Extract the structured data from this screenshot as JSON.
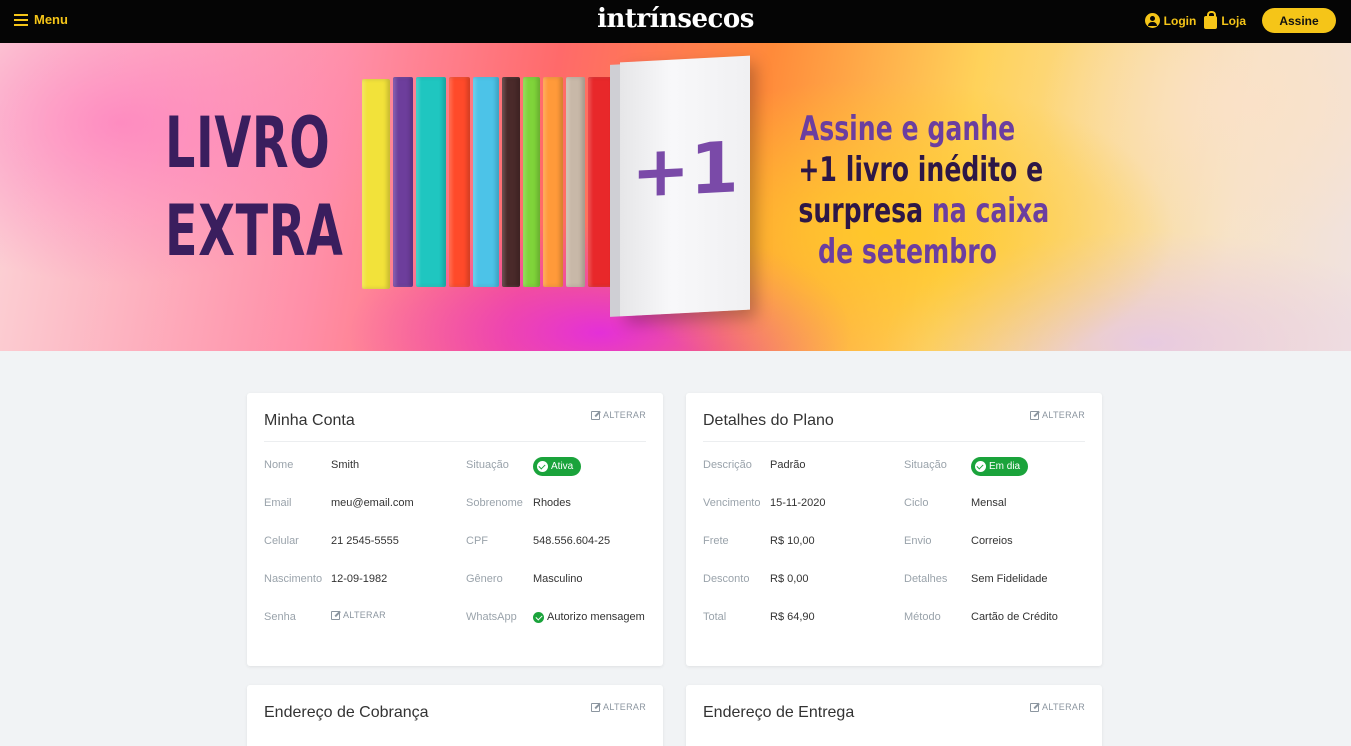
{
  "header": {
    "menu_label": "Menu",
    "logo_text": "intrínsecos",
    "login_label": "Login",
    "loja_label": "Loja",
    "assine_label": "Assine"
  },
  "hero": {
    "left_line1": "LIVRO",
    "left_line2": "EXTRA",
    "plus_one": "+1",
    "right_line1": "Assine e ganhe",
    "right_line2": "+1 livro inédito e",
    "right_line3a": "surpresa",
    "right_line3b": " na caixa",
    "right_line4": "de setembro",
    "book_colors": [
      "#f2e23a",
      "#6d3e9c",
      "#1fc6c0",
      "#ff4a2a",
      "#4cc3e8",
      "#4a2a2a",
      "#7fd43a",
      "#ff9a3a",
      "#c8b8a8",
      "#e8282a",
      "#1a9cc8"
    ]
  },
  "account": {
    "title": "Minha Conta",
    "alterar": "ALTERAR",
    "fields": {
      "nome_label": "Nome",
      "nome": "Smith",
      "situacao_label": "Situação",
      "situacao": "Ativa",
      "email_label": "Email",
      "email": "meu@email.com",
      "sobrenome_label": "Sobrenome",
      "sobrenome": "Rhodes",
      "celular_label": "Celular",
      "celular": "21 2545-5555",
      "cpf_label": "CPF",
      "cpf": "548.556.604-25",
      "nascimento_label": "Nascimento",
      "nascimento": "12-09-1982",
      "genero_label": "Gênero",
      "genero": "Masculino",
      "senha_label": "Senha",
      "senha_alterar": "ALTERAR",
      "whatsapp_label": "WhatsApp",
      "whatsapp": "Autorizo mensagem"
    }
  },
  "plan": {
    "title": "Detalhes do Plano",
    "alterar": "ALTERAR",
    "fields": {
      "descricao_label": "Descrição",
      "descricao": "Padrão",
      "situacao_label": "Situação",
      "situacao": "Em dia",
      "vencimento_label": "Vencimento",
      "vencimento": "15-11-2020",
      "ciclo_label": "Ciclo",
      "ciclo": "Mensal",
      "frete_label": "Frete",
      "frete": "R$ 10,00",
      "envio_label": "Envio",
      "envio": "Correios",
      "desconto_label": "Desconto",
      "desconto": "R$ 0,00",
      "detalhes_label": "Detalhes",
      "detalhes": "Sem Fidelidade",
      "total_label": "Total",
      "total": "R$ 64,90",
      "metodo_label": "Método",
      "metodo": "Cartão de Crédito"
    }
  },
  "billing": {
    "title": "Endereço de Cobrança",
    "alterar": "ALTERAR"
  },
  "shipping": {
    "title": "Endereço de Entrega",
    "alterar": "ALTERAR"
  },
  "colors": {
    "accent": "#f5c518",
    "status_green": "#1aa33b",
    "header_bg": "#050505",
    "hero_purple": "#6b3ea0"
  }
}
